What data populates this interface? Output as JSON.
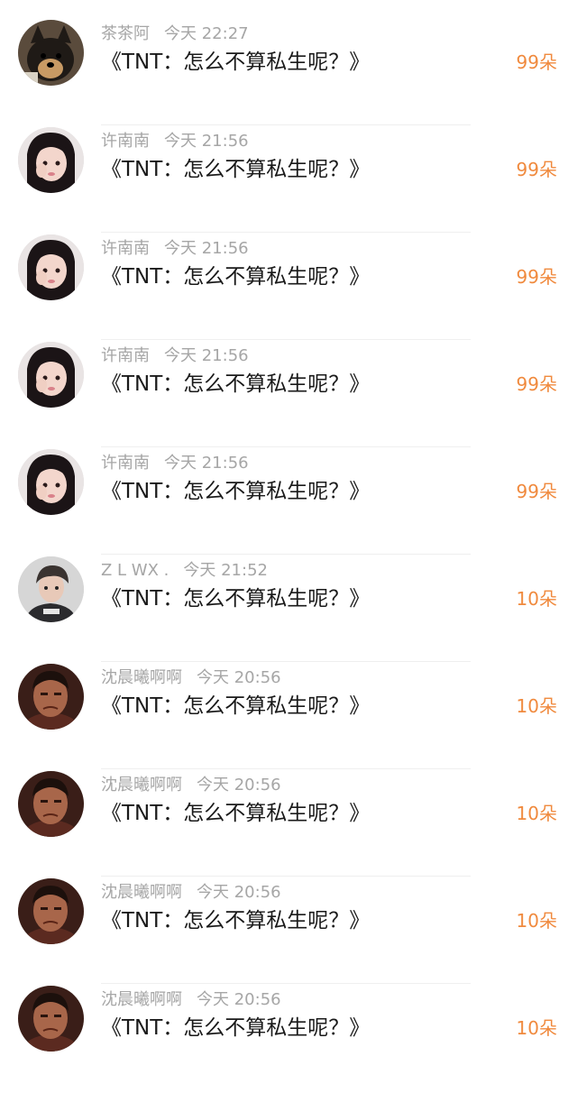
{
  "avatar_icons": [
    "dog-avatar",
    "girl-avatar",
    "boy-avatar",
    "man-avatar"
  ],
  "colors": {
    "count": "#f08a3e",
    "meta": "#a6a6a6",
    "message": "#1a1a1a"
  },
  "messages": [
    {
      "name": "茶茶阿",
      "time": "今天 22:27",
      "text": "《TNT：怎么不算私生呢？》",
      "count": "99朵",
      "avatar": "dog-avatar"
    },
    {
      "name": "许南南",
      "time": "今天 21:56",
      "text": "《TNT：怎么不算私生呢？》",
      "count": "99朵",
      "avatar": "girl-avatar"
    },
    {
      "name": "许南南",
      "time": "今天 21:56",
      "text": "《TNT：怎么不算私生呢？》",
      "count": "99朵",
      "avatar": "girl-avatar"
    },
    {
      "name": "许南南",
      "time": "今天 21:56",
      "text": "《TNT：怎么不算私生呢？》",
      "count": "99朵",
      "avatar": "girl-avatar"
    },
    {
      "name": "许南南",
      "time": "今天 21:56",
      "text": "《TNT：怎么不算私生呢？》",
      "count": "99朵",
      "avatar": "girl-avatar"
    },
    {
      "name": "Z L WX .",
      "time": "今天 21:52",
      "text": "《TNT：怎么不算私生呢？》",
      "count": "10朵",
      "avatar": "boy-avatar"
    },
    {
      "name": "沈晨曦啊啊",
      "time": "今天 20:56",
      "text": "《TNT：怎么不算私生呢？》",
      "count": "10朵",
      "avatar": "man-avatar"
    },
    {
      "name": "沈晨曦啊啊",
      "time": "今天 20:56",
      "text": "《TNT：怎么不算私生呢？》",
      "count": "10朵",
      "avatar": "man-avatar"
    },
    {
      "name": "沈晨曦啊啊",
      "time": "今天 20:56",
      "text": "《TNT：怎么不算私生呢？》",
      "count": "10朵",
      "avatar": "man-avatar"
    },
    {
      "name": "沈晨曦啊啊",
      "time": "今天 20:56",
      "text": "《TNT：怎么不算私生呢？》",
      "count": "10朵",
      "avatar": "man-avatar"
    }
  ]
}
